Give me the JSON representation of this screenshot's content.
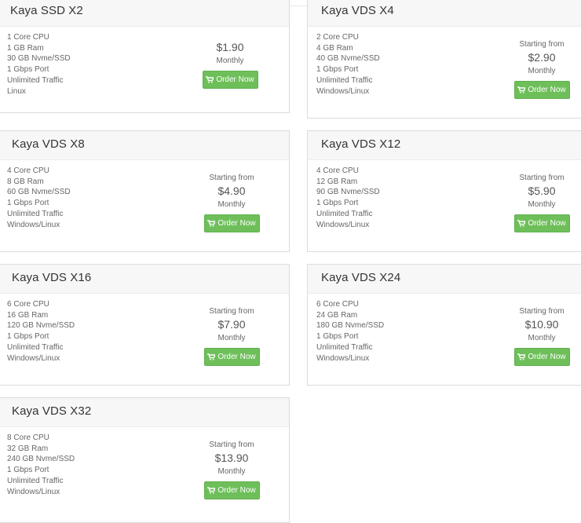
{
  "order_label": "Order Now",
  "plans": [
    {
      "name": "Kaya SSD X2",
      "specs": [
        "1 Core CPU",
        "1 GB Ram",
        "30 GB Nvme/SSD",
        "1 Gbps Port",
        "Unlimited Traffic",
        "Linux"
      ],
      "starting": "",
      "price": "$1.90",
      "period": "Monthly"
    },
    {
      "name": "Kaya VDS X4",
      "specs": [
        "2 Core CPU",
        "4 GB Ram",
        "40 GB Nvme/SSD",
        "1 Gbps Port",
        "Unlimited Traffic",
        "Windows/Linux"
      ],
      "starting": "Starting from",
      "price": "$2.90",
      "period": "Monthly"
    },
    {
      "name": "Kaya VDS X8",
      "specs": [
        "4 Core CPU",
        "8 GB Ram",
        "60 GB Nvme/SSD",
        "1 Gbps Port",
        "Unlimited Traffic",
        "Windows/Linux"
      ],
      "starting": "Starting from",
      "price": "$4.90",
      "period": "Monthly"
    },
    {
      "name": "Kaya VDS X12",
      "specs": [
        "4 Core CPU",
        "12 GB Ram",
        "90 GB Nvme/SSD",
        "1 Gbps Port",
        "Unlimited Traffic",
        "Windows/Linux"
      ],
      "starting": "Starting from",
      "price": "$5.90",
      "period": "Monthly"
    },
    {
      "name": "Kaya VDS X16",
      "specs": [
        "6 Core CPU",
        "16 GB Ram",
        "120 GB Nvme/SSD",
        "1 Gbps Port",
        "Unlimited Traffic",
        "Windows/Linux"
      ],
      "starting": "Starting from",
      "price": "$7.90",
      "period": "Monthly"
    },
    {
      "name": "Kaya VDS X24",
      "specs": [
        "6 Core CPU",
        "24 GB Ram",
        "180 GB Nvme/SSD",
        "1 Gbps Port",
        "Unlimited Traffic",
        "Windows/Linux"
      ],
      "starting": "Starting from",
      "price": "$10.90",
      "period": "Monthly"
    },
    {
      "name": "Kaya VDS X32",
      "specs": [
        "8 Core CPU",
        "32 GB Ram",
        "240 GB Nvme/SSD",
        "1 Gbps Port",
        "Unlimited Traffic",
        "Windows/Linux"
      ],
      "starting": "Starting from",
      "price": "$13.90",
      "period": "Monthly"
    }
  ],
  "colors": {
    "button": "#6ebf5a",
    "header_bg": "#f7f7f7",
    "border": "#dcdcdc"
  },
  "icons": {
    "order_button": "shopping-cart-icon"
  }
}
